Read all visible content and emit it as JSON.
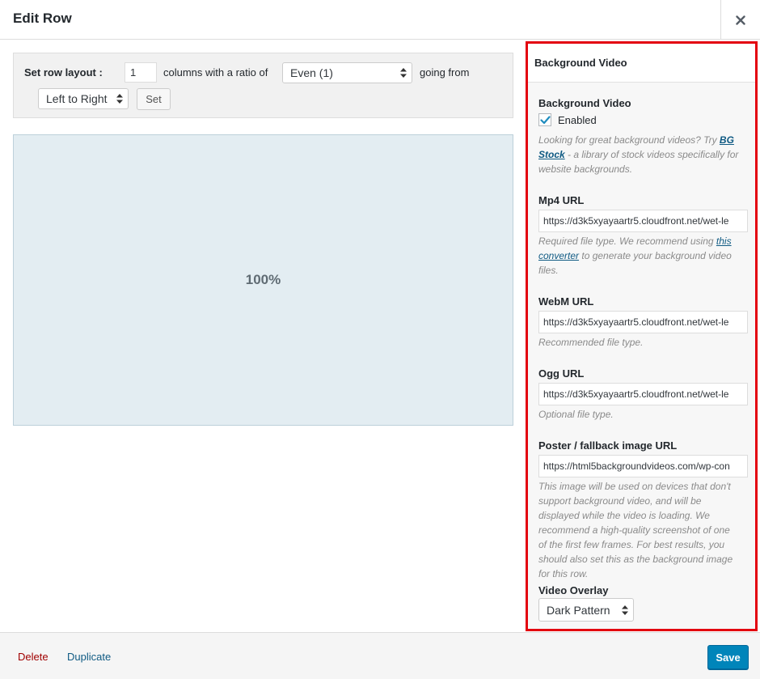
{
  "header": {
    "title": "Edit Row"
  },
  "layout_bar": {
    "label": "Set row layout :",
    "columns_value": "1",
    "text_columns": "columns with a ratio of",
    "ratio_selected": "Even (1)",
    "text_going_from": "going from",
    "direction_selected": "Left to Right",
    "set_label": "Set"
  },
  "cell": {
    "weight": "100%",
    "background": "#e3edf2"
  },
  "panel": {
    "title": "Background Video",
    "bg_video": {
      "label": "Background Video",
      "checkbox_label": "Enabled",
      "checked": true,
      "desc_prefix": "Looking for great background videos? Try ",
      "desc_link": "BG Stock",
      "desc_suffix": " - a library of stock videos specifically for website backgrounds."
    },
    "mp4": {
      "label": "Mp4 URL",
      "value": "https://d3k5xyayaartr5.cloudfront.net/wet-le",
      "desc_prefix": "Required file type. We recommend using ",
      "desc_link1": "this",
      "desc_link2": "converter",
      "desc_suffix": " to generate your background video files."
    },
    "webm": {
      "label": "WebM URL",
      "value": "https://d3k5xyayaartr5.cloudfront.net/wet-le",
      "desc": "Recommended file type."
    },
    "ogg": {
      "label": "Ogg URL",
      "value": "https://d3k5xyayaartr5.cloudfront.net/wet-le",
      "desc": "Optional file type."
    },
    "poster": {
      "label": "Poster / fallback image URL",
      "value": "https://html5backgroundvideos.com/wp-con",
      "desc": "This image will be used on devices that don't support background video, and will be displayed while the video is loading. We recommend a high-quality screenshot of one of the first few frames. For best results, you should also set this as the background image for this row."
    },
    "overlay": {
      "label": "Video Overlay",
      "selected": "Dark Pattern"
    },
    "highlight_color": "#e3000f"
  },
  "footer": {
    "delete_label": "Delete",
    "duplicate_label": "Duplicate",
    "save_label": "Save"
  },
  "colors": {
    "primary": "#0085ba",
    "link": "#0f5a83",
    "delete": "#a00000"
  },
  "icons": {
    "close": "close-icon",
    "select_arrows": "select-arrows-icon",
    "check": "checkmark-icon"
  }
}
